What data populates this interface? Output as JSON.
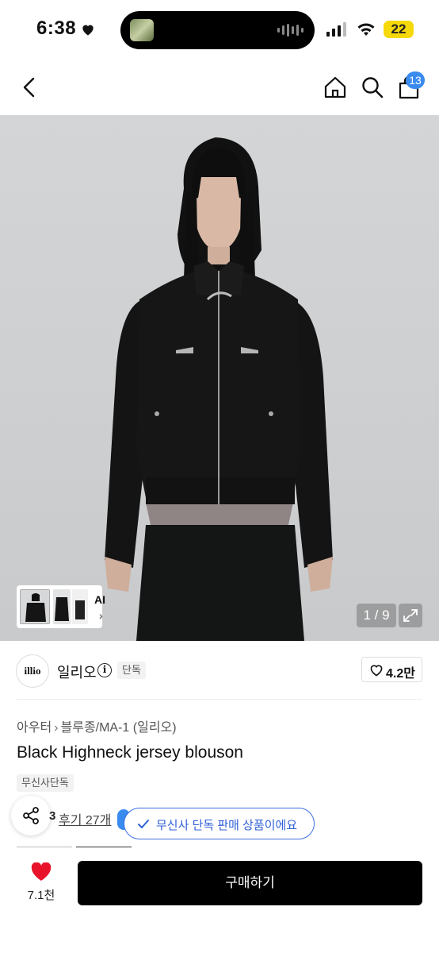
{
  "status_bar": {
    "time": "6:38",
    "battery": "22"
  },
  "nav": {
    "cart_count": "13"
  },
  "gallery": {
    "ai_label": "AI",
    "counter": "1 / 9"
  },
  "brand": {
    "logo_text": "illio",
    "name": "일리오",
    "exclusive_tag": "단독",
    "like_count": "4.2만"
  },
  "product": {
    "category": [
      "아우터",
      "블루종/MA-1 (일리오)"
    ],
    "title": "Black Highneck jersey blouson",
    "badge": "무신사단독",
    "score_tail": "3",
    "review_link": "후기 27개",
    "toast": "무신사 단독 판매 상품이에요"
  },
  "bottom_bar": {
    "wish_count": "7.1천",
    "buy_label": "구매하기"
  },
  "colors": {
    "accent_blue": "#3a8bf0",
    "toast_blue": "#2f5fd6",
    "heart_red": "#e8132a",
    "buy_black": "#000000"
  }
}
